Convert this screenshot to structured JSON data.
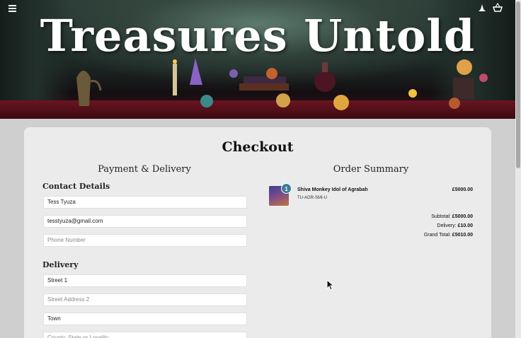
{
  "header": {
    "site_title": "Treasures Untold",
    "menu_icon": "hamburger-menu-icon",
    "icons": [
      "wizard-hat-icon",
      "basket-icon"
    ]
  },
  "checkout": {
    "title": "Checkout",
    "payment_title": "Payment & Delivery",
    "contact_label": "Contact Details",
    "delivery_label": "Delivery",
    "contact": {
      "name_value": "Tess Tyuza",
      "email_value": "tesstyuza@gmail.com",
      "phone_placeholder": "Phone Number"
    },
    "delivery": {
      "street1_value": "Street 1",
      "street2_placeholder": "Street Address 2",
      "town_value": "Town",
      "county_placeholder": "County, State or Locality"
    }
  },
  "summary": {
    "title": "Order Summary",
    "item": {
      "qty": "1",
      "name": "Shiva Monkey Idol of Agrabah",
      "sku": "TU-AGR-SMI-U",
      "price": "£5000.00"
    },
    "subtotal_label": "Subtotal:",
    "subtotal_value": "£5000.00",
    "delivery_label": "Delivery:",
    "delivery_value": "£10.00",
    "grand_total_label": "Grand Total:",
    "grand_total_value": "£5010.00"
  },
  "colors": {
    "badge": "#3b7c9a",
    "card_bg": "#ebebeb",
    "page_bg": "#cfcfcf"
  }
}
